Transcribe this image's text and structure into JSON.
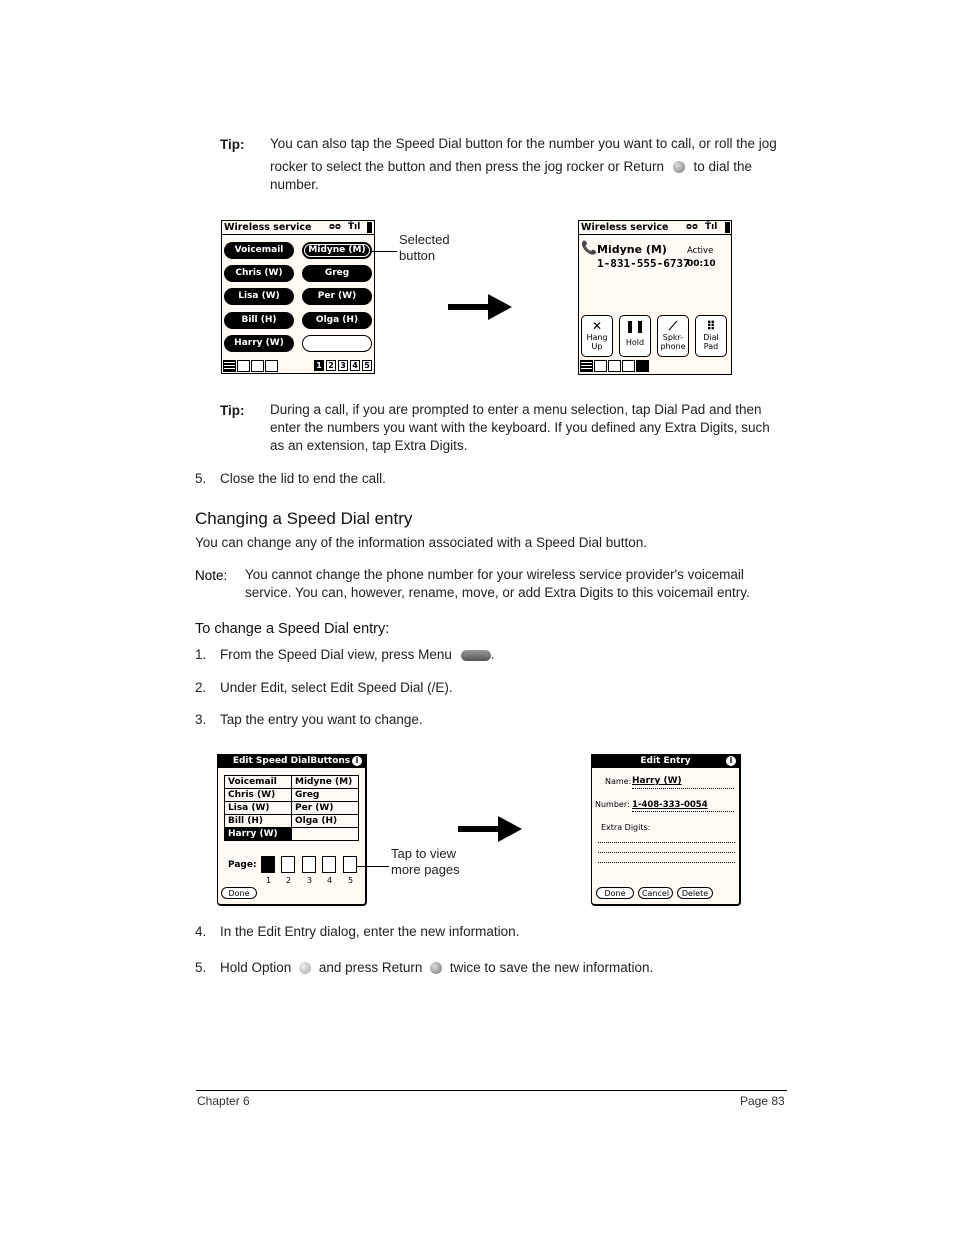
{
  "tip1": {
    "label": "Tip:",
    "line1": "You can also tap the Speed Dial button for the number you want to call, or roll the jog",
    "line2a": "rocker to select the button and then press the jog rocker or Return",
    "line2b": "to dial the",
    "line3": "number.",
    "icon": "return-key-icon"
  },
  "figure1": {
    "speed_dial": {
      "title": "Wireless service",
      "buttons": [
        "Voicemail",
        "Midyne (M)",
        "Chris (W)",
        "Greg",
        "Lisa (W)",
        "Per (W)",
        "Bill (H)",
        "Olga (H)",
        "Harry (W)",
        ""
      ],
      "selected": "Midyne (M)",
      "pages": [
        "1",
        "2",
        "3",
        "4",
        "5"
      ],
      "active_page": "1"
    },
    "callout": {
      "line1": "Selected",
      "line2": "button"
    },
    "active_call": {
      "title": "Wireless service",
      "name": "Midyne (M)",
      "number": "1-831-555-6737",
      "status": "Active",
      "timer": "00:10",
      "buttons": [
        {
          "icon": "x-icon",
          "glyph": "✕",
          "line1": "Hang",
          "line2": "Up"
        },
        {
          "icon": "pause-icon",
          "glyph": "❚❚",
          "line1": "Hold",
          "line2": ""
        },
        {
          "icon": "speakerphone-icon",
          "glyph": "⟋",
          "line1": "Spkr-",
          "line2": "phone"
        },
        {
          "icon": "dialpad-icon",
          "glyph": "⠿",
          "line1": "Dial",
          "line2": "Pad"
        }
      ]
    }
  },
  "tip2": {
    "label": "Tip:",
    "line1": "During a call, if you are prompted to enter a menu selection, tap Dial Pad and then",
    "line2": "enter the numbers you want with the keyboard. If you defined any Extra Digits, such",
    "line3": "as an extension, tap Extra Digits."
  },
  "step5a": {
    "num": "5.",
    "text": "Close the lid to end the call."
  },
  "section": {
    "heading": "Changing a Speed Dial entry",
    "intro": "You can change any of the information associated with a Speed Dial button."
  },
  "note": {
    "label": "Note:",
    "line1": "You cannot change the phone number for your wireless service provider's voicemail",
    "line2": "service. You can, however, rename, move, or add Extra Digits to this voicemail entry."
  },
  "procedure": {
    "heading": "To change a Speed Dial entry:",
    "steps": [
      {
        "num": "1.",
        "text": "From the Speed Dial view, press Menu",
        "suffix": "."
      },
      {
        "num": "2.",
        "text": "Under Edit, select Edit Speed Dial (/E)."
      },
      {
        "num": "3.",
        "text": "Tap the entry you want to change."
      },
      {
        "num": "4.",
        "text": "In the Edit Entry dialog, enter the new information."
      },
      {
        "num": "5.",
        "text_a": "Hold Option",
        "text_b": "and press Return",
        "text_c": "twice to save the new information."
      }
    ]
  },
  "figure2": {
    "edit_buttons": {
      "title": "Edit Speed DialButtons",
      "rows": [
        [
          "Voicemail",
          "Midyne (M)"
        ],
        [
          "Chris (W)",
          "Greg"
        ],
        [
          "Lisa (W)",
          "Per (W)"
        ],
        [
          "Bill (H)",
          "Olga (H)"
        ],
        [
          "Harry (W)",
          ""
        ]
      ],
      "highlighted": "Harry (W)",
      "page_label": "Page:",
      "pages": [
        "1",
        "2",
        "3",
        "4",
        "5"
      ],
      "done": "Done"
    },
    "callout": {
      "line1": "Tap to view",
      "line2": "more pages"
    },
    "edit_entry": {
      "title": "Edit Entry",
      "name_label": "Name:",
      "name_value": "Harry (W)",
      "number_label": "Number:",
      "number_value": "1-408-333-0054",
      "extra_label": "Extra Digits:",
      "buttons": [
        "Done",
        "Cancel",
        "Delete"
      ]
    }
  },
  "footer": {
    "chapter": "Chapter 6",
    "page": "Page 83"
  }
}
